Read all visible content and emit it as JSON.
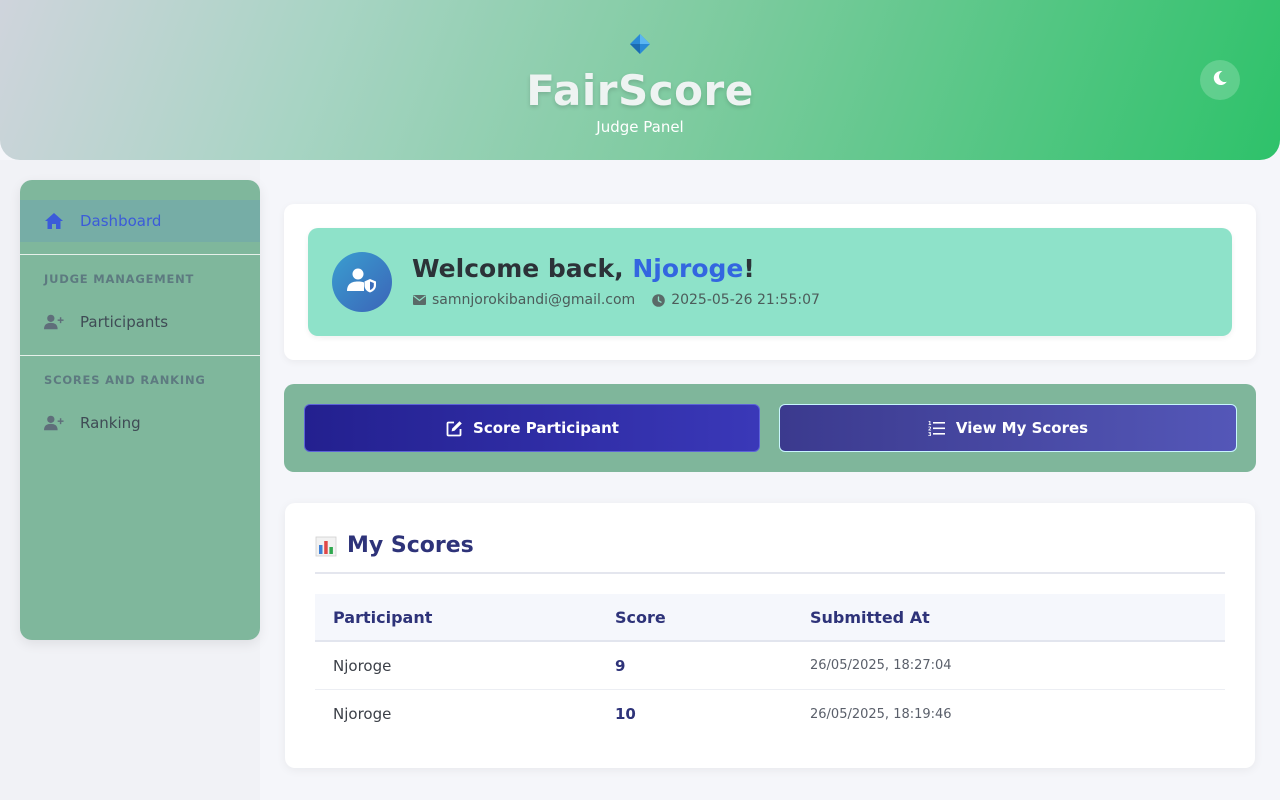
{
  "header": {
    "title": "FairScore",
    "subtitle": "Judge Panel",
    "logo_icon": "diamond-icon",
    "theme_icon": "moon-icon",
    "gradient": [
      "#cfd4dc",
      "#2ec26a"
    ]
  },
  "sidebar": {
    "dashboard": {
      "label": "Dashboard",
      "icon": "home-icon"
    },
    "sections": [
      {
        "title": "JUDGE MANAGEMENT",
        "items": [
          {
            "label": "Participants",
            "icon": "user-plus-icon"
          }
        ]
      },
      {
        "title": "SCORES AND RANKING",
        "items": [
          {
            "label": "Ranking",
            "icon": "user-plus-icon"
          }
        ]
      }
    ]
  },
  "welcome": {
    "prefix": "Welcome back, ",
    "name": "Njoroge",
    "suffix": "!",
    "email": "samnjorokibandi@gmail.com",
    "datetime": "2025-05-26 21:55:07",
    "avatar_icon": "user-shield-icon"
  },
  "actions": {
    "score_label": "Score Participant",
    "view_label": "View My Scores"
  },
  "scores": {
    "title": "My Scores",
    "columns": [
      "Participant",
      "Score",
      "Submitted At"
    ],
    "rows": [
      {
        "participant": "Njoroge",
        "score": "9",
        "submitted": "26/05/2025, 18:27:04"
      },
      {
        "participant": "Njoroge",
        "score": "10",
        "submitted": "26/05/2025, 18:19:46"
      }
    ]
  },
  "colors": {
    "accent": "#3366e0",
    "primary_button": "#23208f",
    "sidebar": "#7fb79c",
    "welcome_bg": "#8ee2c9"
  }
}
